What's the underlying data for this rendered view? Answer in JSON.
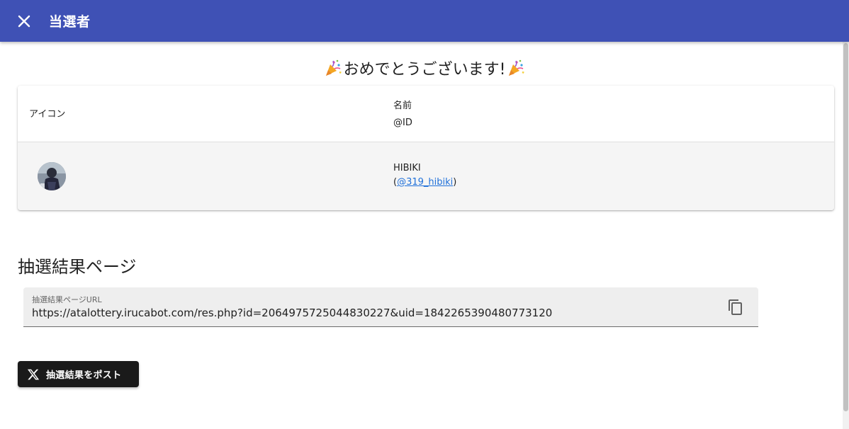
{
  "header": {
    "title": "当選者",
    "close_icon": "close-icon",
    "background_color": "#3f51b5"
  },
  "congrats": {
    "text": "おめでとうございます!",
    "icon": "party-popper-icon"
  },
  "winners_table": {
    "headers": {
      "icon": "アイコン",
      "name": "名前",
      "id": "@ID"
    },
    "rows": [
      {
        "avatar": "user-avatar",
        "name": "HIBIKI",
        "id_prefix": "(",
        "handle": "@319_hibiki",
        "id_suffix": ")"
      }
    ]
  },
  "results_section": {
    "title": "抽選結果ページ",
    "url_field": {
      "label": "抽選結果ページURL",
      "value": "https://atalottery.irucabot.com/res.php?id=2064975725044830227&uid=1842265390480773120"
    },
    "copy_icon": "copy-icon"
  },
  "post_button": {
    "label": "抽選結果をポスト",
    "icon": "x-logo-icon",
    "background_color": "#1a1a1a"
  }
}
